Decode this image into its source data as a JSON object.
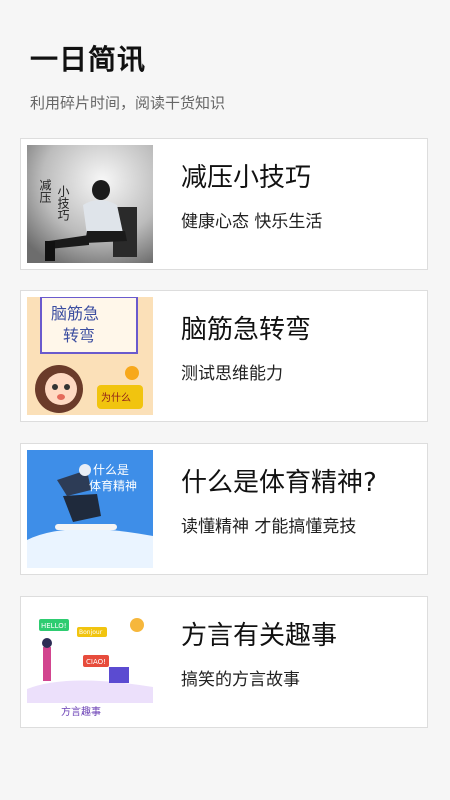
{
  "header": {
    "title": "一日简讯",
    "subtitle": "利用碎片时间，阅读干货知识"
  },
  "cards": [
    {
      "title": "减压小技巧",
      "subtitle": "健康心态 快乐生活",
      "thumb_text": [
        "减压",
        "小技巧"
      ],
      "image": "stressed-man-image"
    },
    {
      "title": "脑筋急转弯",
      "subtitle": "测试思维能力",
      "thumb_text": [
        "脑筋急",
        "转弯",
        "为什么"
      ],
      "image": "brain-teaser-cartoon-image"
    },
    {
      "title": "什么是体育精神?",
      "subtitle": "读懂精神 才能搞懂竞技",
      "thumb_text": [
        "什么是",
        "体育精神"
      ],
      "image": "snowboarder-image"
    },
    {
      "title": "方言有关趣事",
      "subtitle": "搞笑的方言故事",
      "thumb_text": [
        "HELLO!",
        "Bonjour",
        "CIAO!",
        "方言趣事"
      ],
      "image": "dialect-illustration-image"
    }
  ]
}
